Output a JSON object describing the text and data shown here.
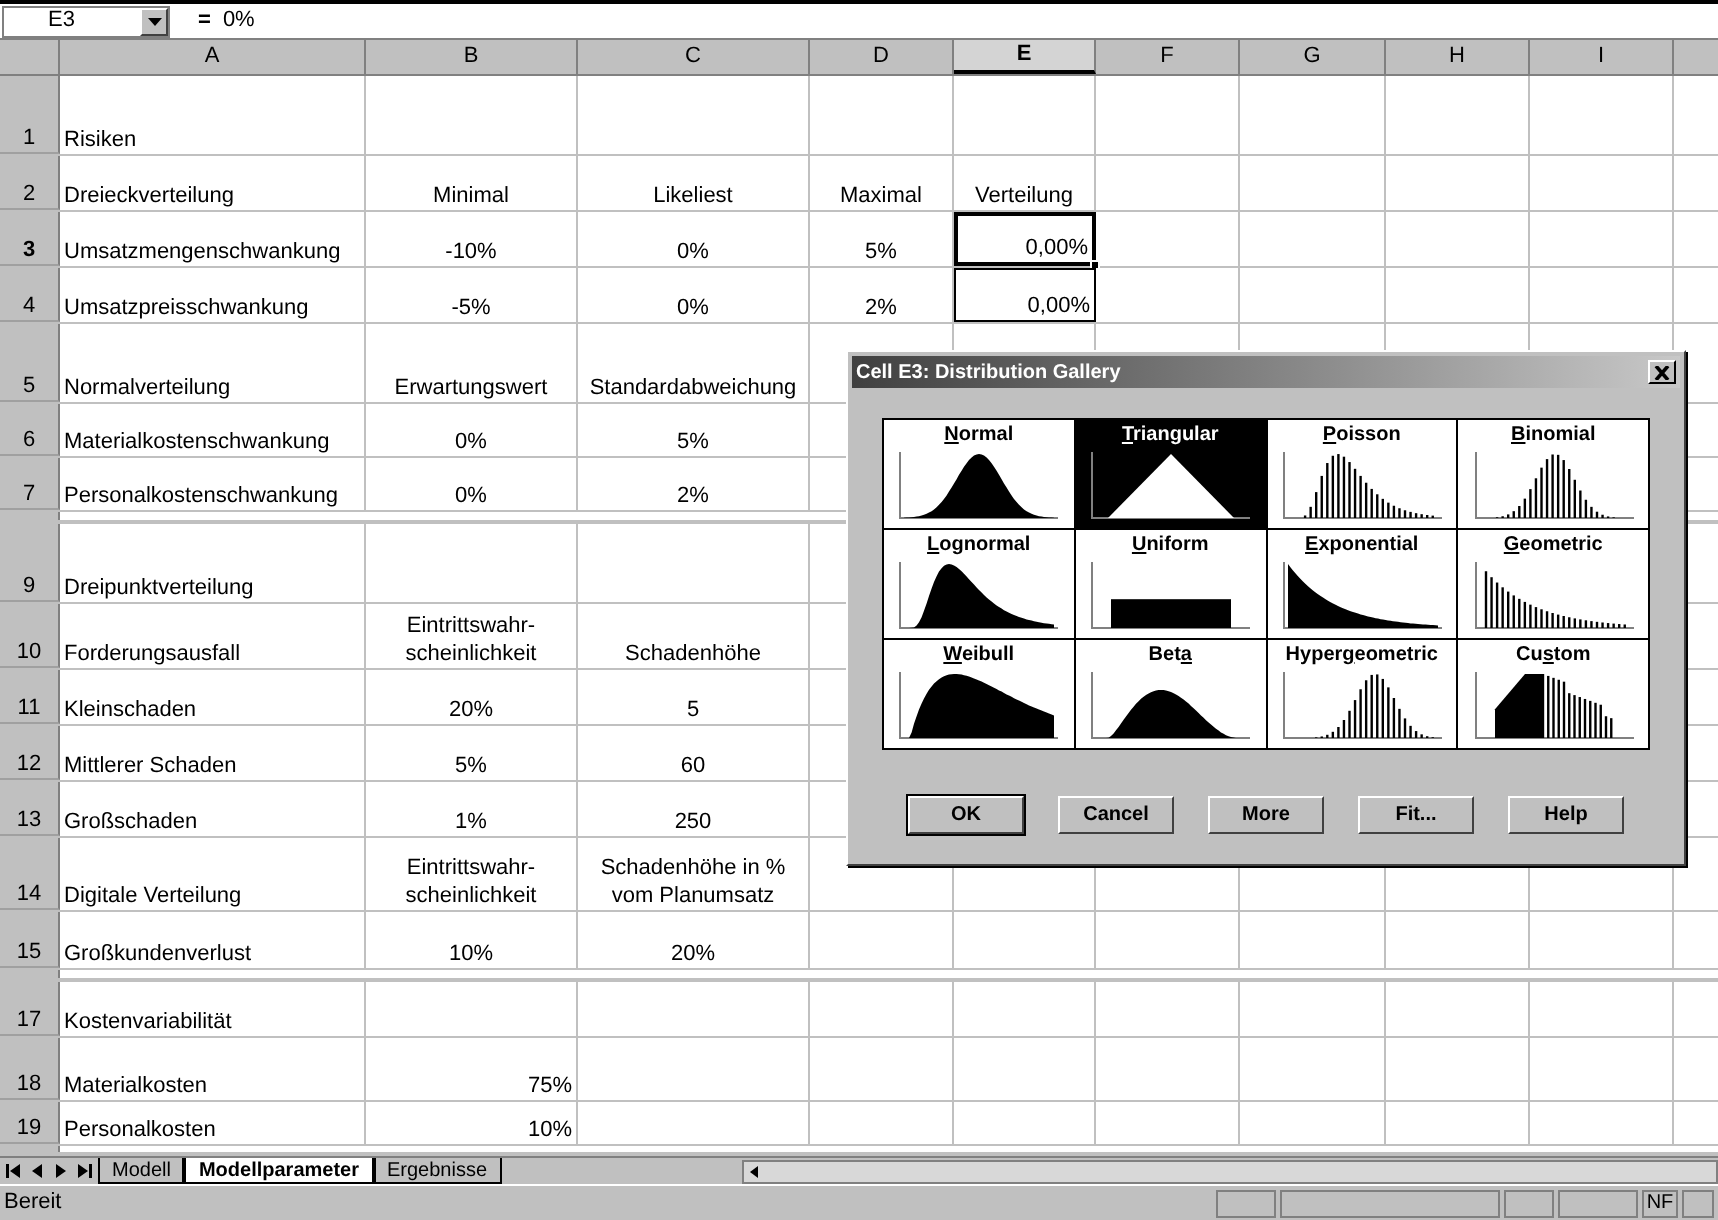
{
  "formula_bar": {
    "name_box": "E3",
    "equals": "=",
    "formula": "0%"
  },
  "columns": [
    {
      "label": "A",
      "selected": false
    },
    {
      "label": "B",
      "selected": false
    },
    {
      "label": "C",
      "selected": false
    },
    {
      "label": "D",
      "selected": false
    },
    {
      "label": "E",
      "selected": true
    },
    {
      "label": "F",
      "selected": false
    },
    {
      "label": "G",
      "selected": false
    },
    {
      "label": "H",
      "selected": false
    },
    {
      "label": "I",
      "selected": false
    }
  ],
  "rows": [
    {
      "kind": "row",
      "number": "1",
      "selected": false,
      "cells": {
        "A": {
          "text": "Risiken",
          "selected": false
        }
      }
    },
    {
      "kind": "row",
      "number": "2",
      "selected": false,
      "cells": {
        "A": {
          "text": "Dreieckverteilung",
          "selected": false
        },
        "B": {
          "text": "Minimal",
          "selected": false
        },
        "C": {
          "text": "Likeliest",
          "selected": false
        },
        "D": {
          "text": "Maximal",
          "selected": false
        },
        "E": {
          "text": "Verteilung",
          "selected": false
        }
      }
    },
    {
      "kind": "row",
      "number": "3",
      "selected": true,
      "cells": {
        "A": {
          "text": "Umsatzmengenschwankung",
          "selected": false
        },
        "B": {
          "text": "-10%",
          "selected": false
        },
        "C": {
          "text": "0%",
          "selected": false
        },
        "D": {
          "text": "5%",
          "selected": false
        },
        "E": {
          "text": "0,00%",
          "right_aligned": true,
          "bordered": true,
          "selected": true
        }
      }
    },
    {
      "kind": "row",
      "number": "4",
      "selected": false,
      "cells": {
        "A": {
          "text": "Umsatzpreisschwankung",
          "selected": false
        },
        "B": {
          "text": "-5%",
          "selected": false
        },
        "C": {
          "text": "0%",
          "selected": false
        },
        "D": {
          "text": "2%",
          "selected": false
        },
        "E": {
          "text": "0,00%",
          "right_aligned": true,
          "bordered": true,
          "selected": false
        }
      }
    },
    {
      "kind": "row",
      "number": "5",
      "selected": false,
      "cells": {
        "A": {
          "text": "Normalverteilung",
          "selected": false
        },
        "B": {
          "text": "Erwartungswert",
          "selected": false
        },
        "C": {
          "text": "Standardabweichung",
          "selected": false
        }
      }
    },
    {
      "kind": "row",
      "number": "6",
      "selected": false,
      "cells": {
        "A": {
          "text": "Materialkostenschwankung",
          "selected": false
        },
        "B": {
          "text": "0%",
          "selected": false
        },
        "C": {
          "text": "5%",
          "selected": false
        }
      }
    },
    {
      "kind": "row",
      "number": "7",
      "selected": false,
      "cells": {
        "A": {
          "text": "Personalkostenschwankung",
          "selected": false
        },
        "B": {
          "text": "0%",
          "selected": false
        },
        "C": {
          "text": "2%",
          "selected": false
        }
      }
    },
    {
      "kind": "collapsed"
    },
    {
      "kind": "row",
      "number": "9",
      "selected": false,
      "cells": {
        "A": {
          "text": "Dreipunktverteilung",
          "selected": false
        }
      }
    },
    {
      "kind": "row",
      "number": "10",
      "selected": false,
      "cells": {
        "A": {
          "text": "Forderungsausfall",
          "selected": false
        },
        "B": {
          "text": "Eintrittswahr-\nscheinlichkeit",
          "selected": false
        },
        "C": {
          "text": "Schadenhöhe",
          "selected": false
        }
      }
    },
    {
      "kind": "row",
      "number": "11",
      "selected": false,
      "cells": {
        "A": {
          "text": "Kleinschaden",
          "selected": false
        },
        "B": {
          "text": "20%",
          "selected": false
        },
        "C": {
          "text": "5",
          "selected": false
        }
      }
    },
    {
      "kind": "row",
      "number": "12",
      "selected": false,
      "cells": {
        "A": {
          "text": "Mittlerer Schaden",
          "selected": false
        },
        "B": {
          "text": "5%",
          "selected": false
        },
        "C": {
          "text": "60",
          "selected": false
        }
      }
    },
    {
      "kind": "row",
      "number": "13",
      "selected": false,
      "cells": {
        "A": {
          "text": "Großschaden",
          "selected": false
        },
        "B": {
          "text": "1%",
          "selected": false
        },
        "C": {
          "text": "250",
          "selected": false
        }
      }
    },
    {
      "kind": "row",
      "number": "14",
      "selected": false,
      "cells": {
        "A": {
          "text": "Digitale Verteilung",
          "selected": false
        },
        "B": {
          "text": "Eintrittswahr-\nscheinlichkeit",
          "selected": false
        },
        "C": {
          "text": "Schadenhöhe in %\nvom Planumsatz",
          "selected": false
        }
      }
    },
    {
      "kind": "row",
      "number": "15",
      "selected": false,
      "cells": {
        "A": {
          "text": "Großkundenverlust",
          "selected": false
        },
        "B": {
          "text": "10%",
          "selected": false
        },
        "C": {
          "text": "20%",
          "selected": false
        }
      }
    },
    {
      "kind": "collapsed"
    },
    {
      "kind": "row",
      "number": "17",
      "selected": false,
      "cells": {
        "A": {
          "text": "Kostenvariabilität",
          "selected": false
        }
      }
    },
    {
      "kind": "row",
      "number": "18",
      "selected": false,
      "cells": {
        "A": {
          "text": "Materialkosten",
          "selected": false
        },
        "B": {
          "text": "75%",
          "right_aligned": true,
          "selected": false
        }
      }
    },
    {
      "kind": "row",
      "number": "19",
      "selected": false,
      "cells": {
        "A": {
          "text": "Personalkosten",
          "selected": false
        },
        "B": {
          "text": "10%",
          "right_aligned": true,
          "selected": false
        }
      }
    },
    {
      "kind": "collapsed"
    }
  ],
  "sheet_tabs": [
    {
      "label": "Modell",
      "selected": false
    },
    {
      "label": "Modellparameter",
      "selected": true
    },
    {
      "label": "Ergebnisse",
      "selected": false
    }
  ],
  "status_bar": {
    "text": "Bereit",
    "indicator": "NF"
  },
  "dialog": {
    "title": "Cell E3: Distribution Gallery",
    "distributions": [
      {
        "label": {
          "key": "N",
          "after": "ormal"
        },
        "kind": "normal",
        "selected": false
      },
      {
        "label": {
          "key": "T",
          "after": "riangular"
        },
        "kind": "triangular",
        "selected": true
      },
      {
        "label": {
          "key": "P",
          "after": "oisson"
        },
        "kind": "poisson",
        "selected": false
      },
      {
        "label": {
          "key": "B",
          "after": "inomial"
        },
        "kind": "binomial",
        "selected": false
      },
      {
        "label": {
          "key": "L",
          "after": "ognormal"
        },
        "kind": "lognormal",
        "selected": false
      },
      {
        "label": {
          "key": "U",
          "after": "niform"
        },
        "kind": "uniform",
        "selected": false
      },
      {
        "label": {
          "key": "E",
          "after": "xponential"
        },
        "kind": "exponential",
        "selected": false
      },
      {
        "label": {
          "key": "G",
          "after": "eometric"
        },
        "kind": "geometric",
        "selected": false
      },
      {
        "label": {
          "key": "W",
          "after": "eibull"
        },
        "kind": "weibull",
        "selected": false
      },
      {
        "label": {
          "before": "Bet",
          "key": "a"
        },
        "kind": "beta",
        "selected": false
      },
      {
        "label": {
          "before": "Hyper",
          "key": "g",
          "after": "eometric"
        },
        "kind": "hypergeometric",
        "selected": false
      },
      {
        "label": {
          "before": "Cu",
          "key": "s",
          "after": "tom"
        },
        "kind": "custom",
        "selected": false
      }
    ],
    "buttons": [
      {
        "label": "OK",
        "default": true
      },
      {
        "label": "Cancel",
        "default": false
      },
      {
        "label": "More",
        "default": false
      },
      {
        "label": "Fit...",
        "default": false
      },
      {
        "label": "Help",
        "default": false
      }
    ]
  }
}
